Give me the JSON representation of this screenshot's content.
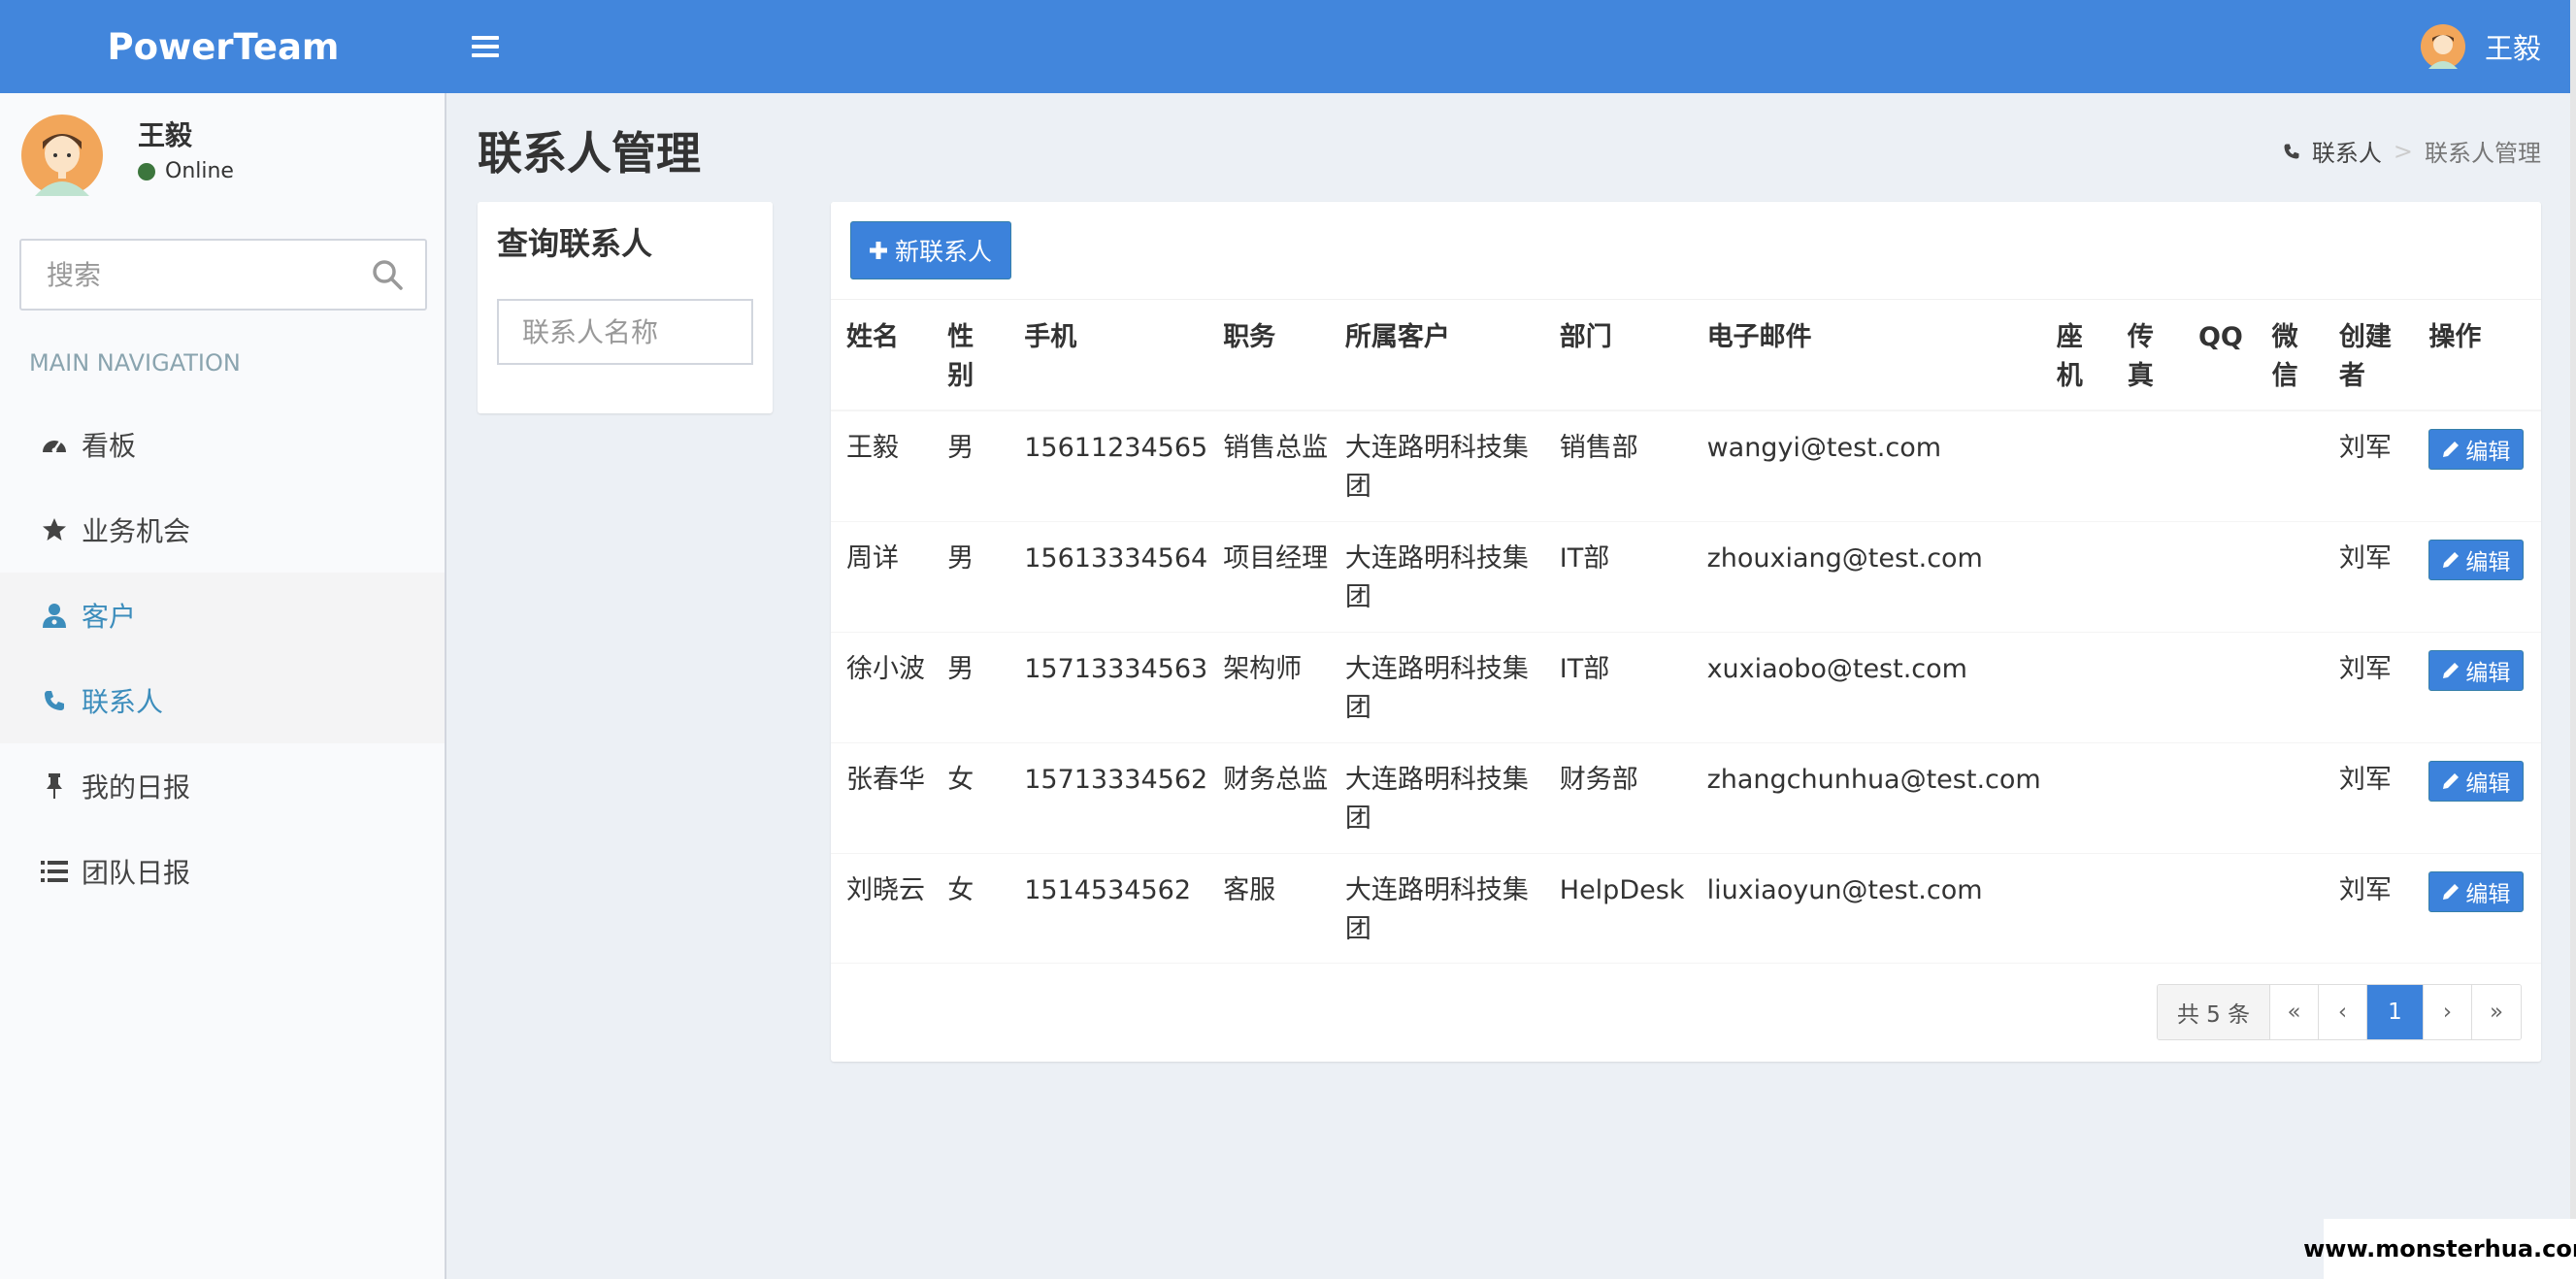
{
  "app": {
    "logo": "PowerTeam"
  },
  "header": {
    "user_name": "王毅"
  },
  "sidebar": {
    "user": {
      "name": "王毅",
      "status": "Online"
    },
    "search_placeholder": "搜索",
    "nav_header": "MAIN NAVIGATION",
    "items": [
      {
        "label": "看板",
        "icon": "dashboard-icon"
      },
      {
        "label": "业务机会",
        "icon": "star-icon"
      },
      {
        "label": "客户",
        "icon": "user-md-icon"
      },
      {
        "label": "联系人",
        "icon": "phone-icon"
      },
      {
        "label": "我的日报",
        "icon": "pushpin-icon"
      },
      {
        "label": "团队日报",
        "icon": "list-icon"
      }
    ]
  },
  "page": {
    "title": "联系人管理",
    "breadcrumb": {
      "parent": "联系人",
      "current": "联系人管理"
    }
  },
  "query": {
    "title": "查询联系人",
    "name_placeholder": "联系人名称"
  },
  "contacts": {
    "new_button": "新联系人",
    "columns": [
      "姓名",
      "性别",
      "手机",
      "职务",
      "所属客户",
      "部门",
      "电子邮件",
      "座机",
      "传真",
      "QQ",
      "微信",
      "创建者",
      "操作"
    ],
    "rows": [
      {
        "name": "王毅",
        "gender": "男",
        "mobile": "15611234565",
        "title": "销售总监",
        "customer": "大连路明科技集团",
        "dept": "销售部",
        "email": "wangyi@test.com",
        "phone": "",
        "fax": "",
        "qq": "",
        "wechat": "",
        "creator": "刘军"
      },
      {
        "name": "周详",
        "gender": "男",
        "mobile": "15613334564",
        "title": "项目经理",
        "customer": "大连路明科技集团",
        "dept": "IT部",
        "email": "zhouxiang@test.com",
        "phone": "",
        "fax": "",
        "qq": "",
        "wechat": "",
        "creator": "刘军"
      },
      {
        "name": "徐小波",
        "gender": "男",
        "mobile": "15713334563",
        "title": "架构师",
        "customer": "大连路明科技集团",
        "dept": "IT部",
        "email": "xuxiaobo@test.com",
        "phone": "",
        "fax": "",
        "qq": "",
        "wechat": "",
        "creator": "刘军"
      },
      {
        "name": "张春华",
        "gender": "女",
        "mobile": "15713334562",
        "title": "财务总监",
        "customer": "大连路明科技集团",
        "dept": "财务部",
        "email": "zhangchunhua@test.com",
        "phone": "",
        "fax": "",
        "qq": "",
        "wechat": "",
        "creator": "刘军"
      },
      {
        "name": "刘晓云",
        "gender": "女",
        "mobile": "1514534562",
        "title": "客服",
        "customer": "大连路明科技集团",
        "dept": "HelpDesk",
        "email": "liuxiaoyun@test.com",
        "phone": "",
        "fax": "",
        "qq": "",
        "wechat": "",
        "creator": "刘军"
      }
    ],
    "edit_label": "编辑",
    "pagination": {
      "total": "共 5 条",
      "first": "«",
      "prev": "‹",
      "current": "1",
      "next": "›",
      "last": "»"
    }
  },
  "watermark": "www.monsterhua.com",
  "colors": {
    "header": "#4286dc",
    "primary_button": "#3c82db",
    "sidebar_bg": "#f9fafc",
    "content_bg": "#ecf0f5",
    "online": "#3c763d"
  }
}
